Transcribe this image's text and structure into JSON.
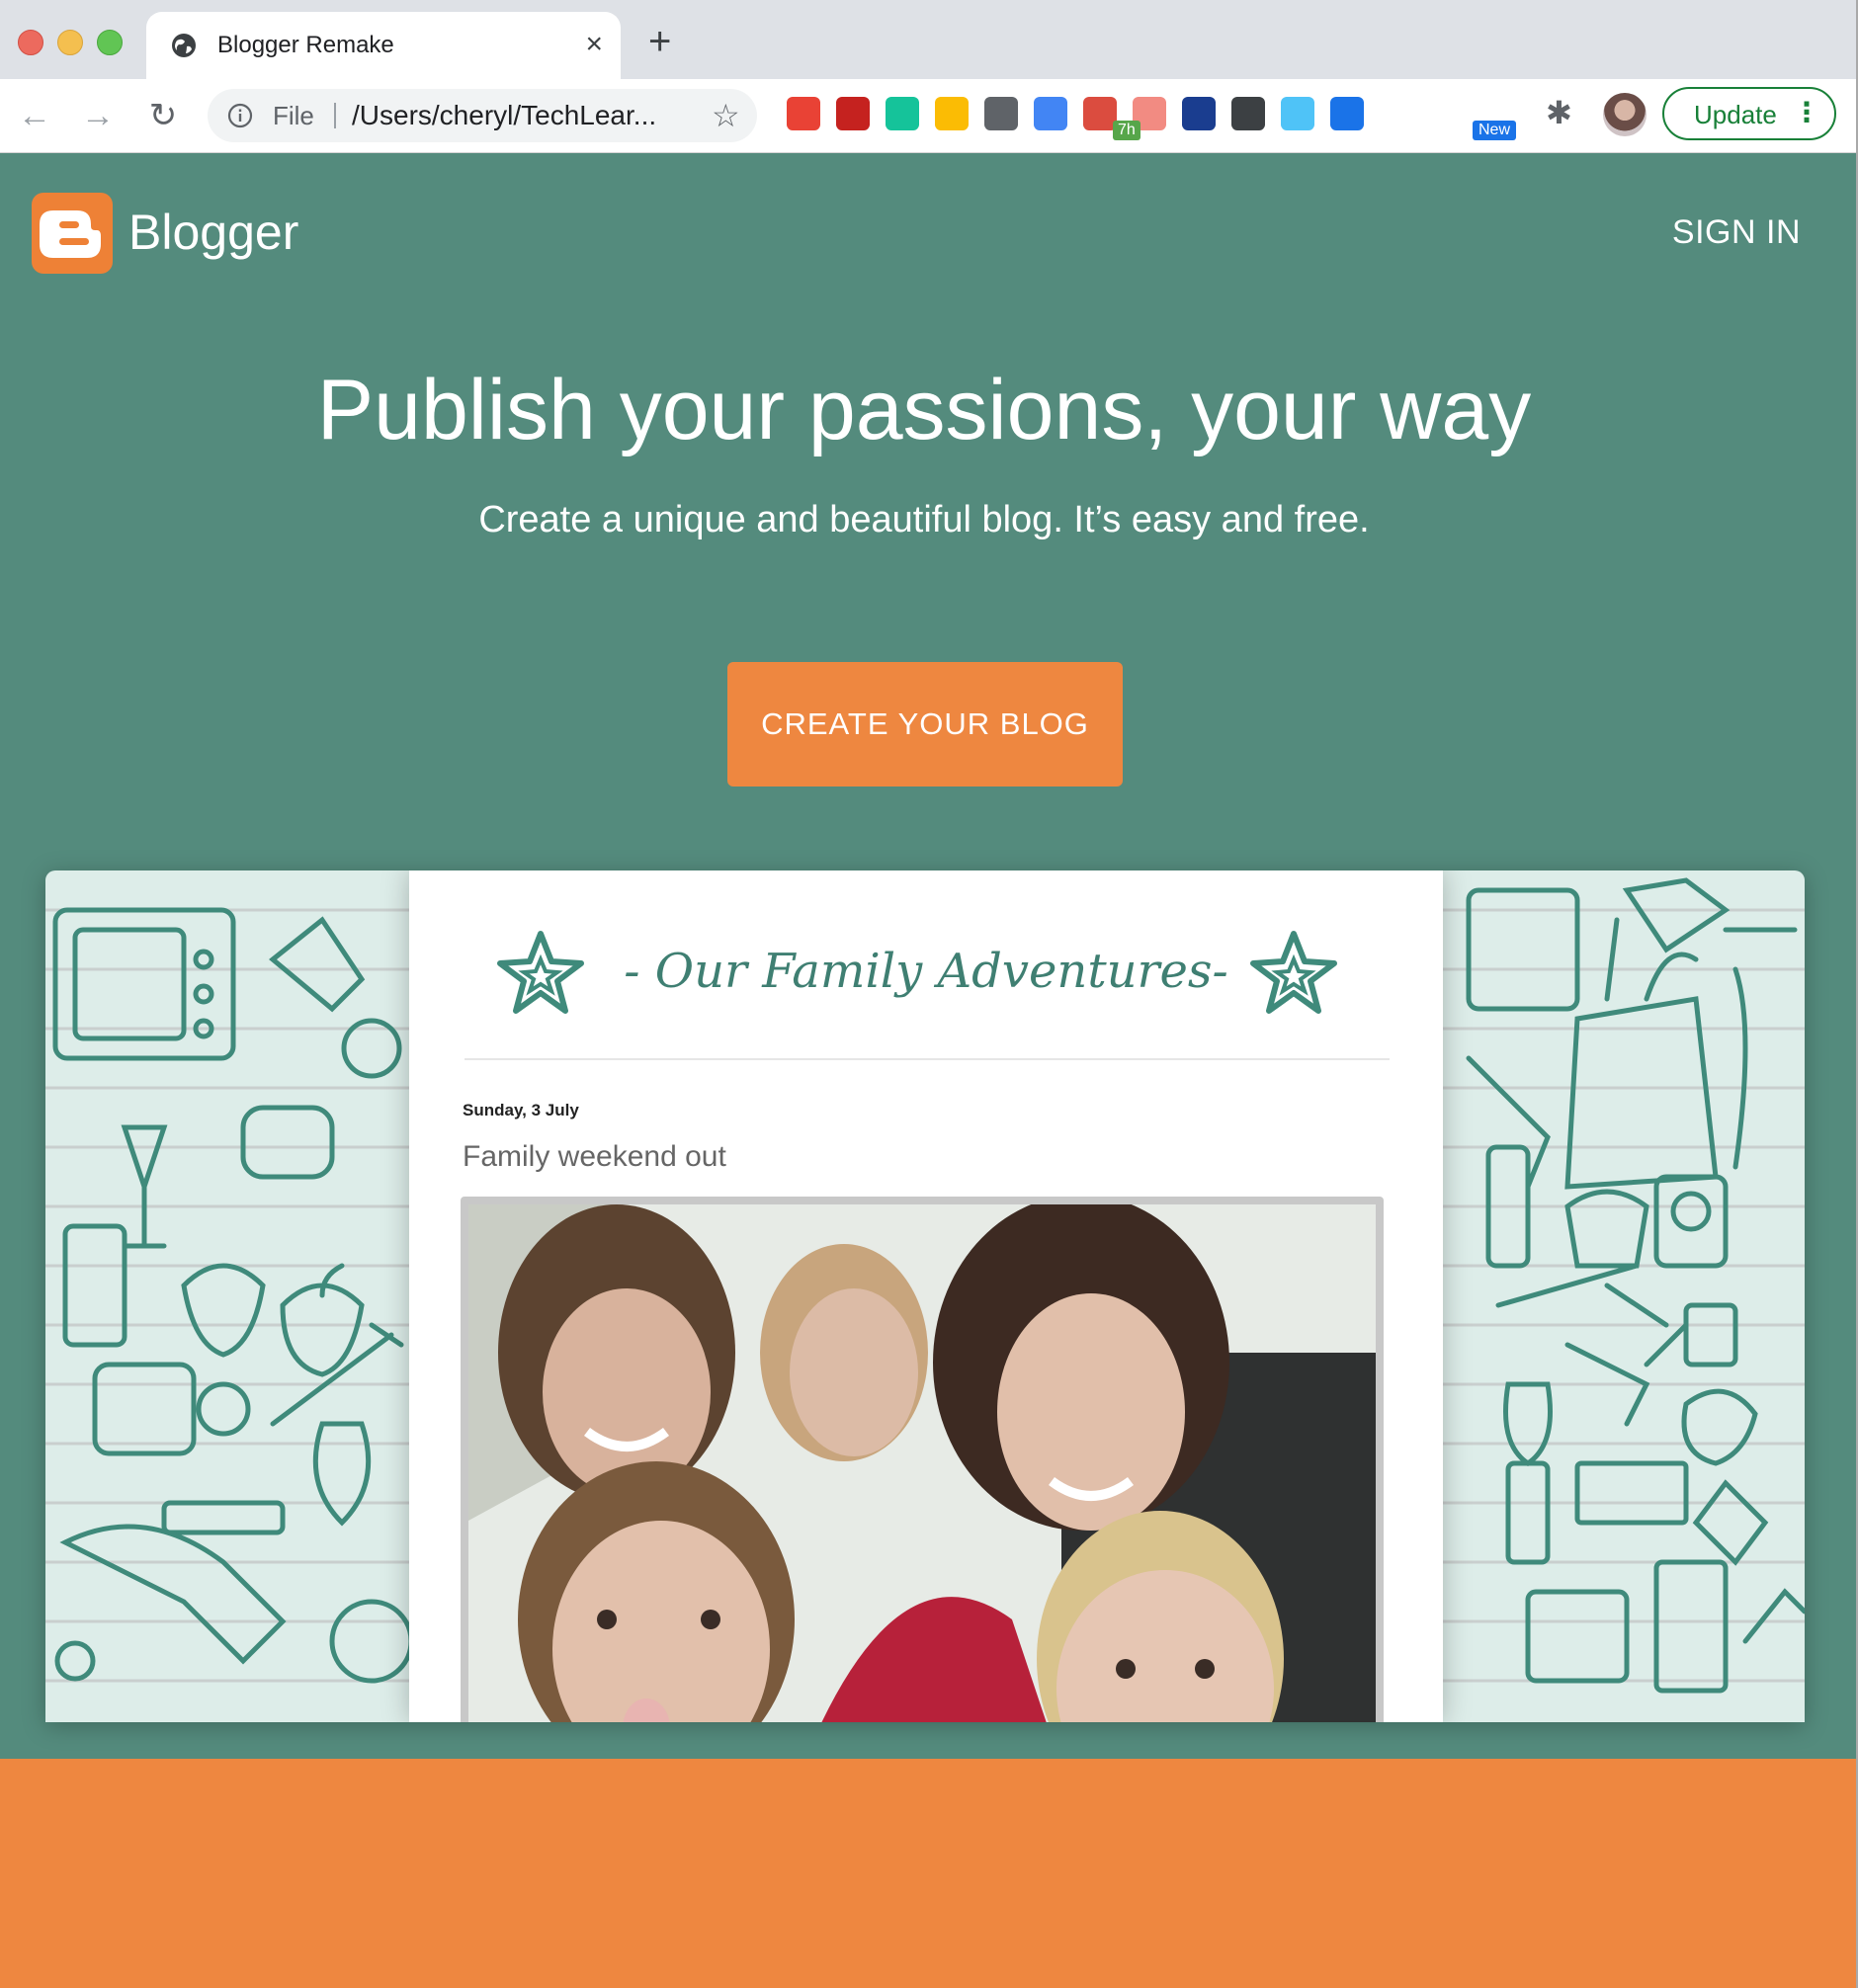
{
  "browser": {
    "tab_title": "Blogger Remake",
    "tab_close": "×",
    "new_tab": "+",
    "address": {
      "scheme_label": "File",
      "url": "/Users/cheryl/TechLear..."
    },
    "extensions": [
      {
        "name": "eyes-extension",
        "color": "#e94235"
      },
      {
        "name": "book-extension",
        "color": "#c5221f"
      },
      {
        "name": "grammarly-extension",
        "color": "#15c39a"
      },
      {
        "name": "colorful-extension",
        "color": "#fbbc04"
      },
      {
        "name": "ghost-extension",
        "color": "#5f6368"
      },
      {
        "name": "calendar-extension",
        "color": "#4285f4",
        "badge": "7h"
      },
      {
        "name": "todoist-extension",
        "color": "#db4c3f"
      },
      {
        "name": "arrow-extension",
        "color": "#f28b82"
      },
      {
        "name": "funnel-extension",
        "color": "#1a3d8f"
      },
      {
        "name": "record-extension",
        "color": "#3c4043"
      },
      {
        "name": "owl-extension",
        "color": "#4fc3f7"
      },
      {
        "name": "new-extension",
        "color": "#1a73e8",
        "badge": "New"
      }
    ],
    "update_label": "Update"
  },
  "page": {
    "brand": "Blogger",
    "sign_in": "SIGN IN",
    "headline": "Publish your passions, your way",
    "subhead": "Create a unique and beautiful blog. It’s easy and free.",
    "cta": "CREATE YOUR BLOG",
    "preview": {
      "blog_title": "- Our Family Adventures-",
      "post_date": "Sunday, 3 July",
      "post_title": "Family weekend out"
    },
    "colors": {
      "background": "#548b7d",
      "accent": "#ee8740",
      "footer": "#ee8740"
    }
  }
}
